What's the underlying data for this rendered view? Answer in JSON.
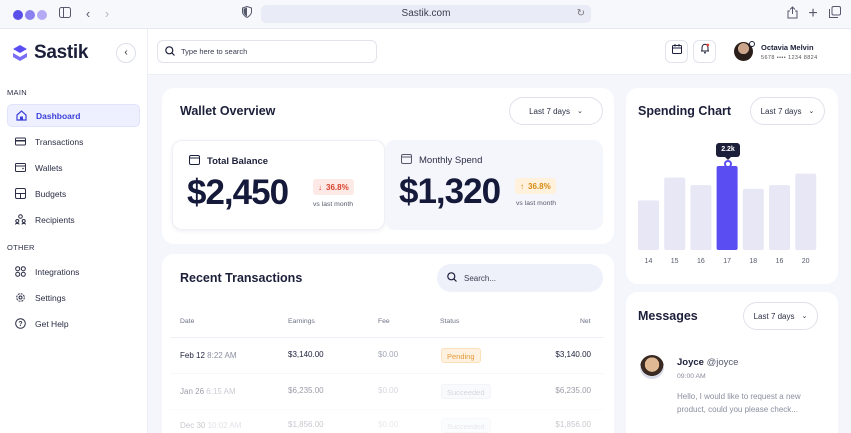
{
  "browser": {
    "url": "Sastik.com"
  },
  "brand": {
    "name": "Sastik",
    "accent": "#5a4df2"
  },
  "sidebar": {
    "main_label": "MAIN",
    "other_label": "OTHER",
    "main_items": [
      {
        "label": "Dashboard",
        "icon": "home-icon",
        "active": true
      },
      {
        "label": "Transactions",
        "icon": "card-icon"
      },
      {
        "label": "Wallets",
        "icon": "wallet-icon"
      },
      {
        "label": "Budgets",
        "icon": "budget-icon"
      },
      {
        "label": "Recipients",
        "icon": "users-icon"
      }
    ],
    "other_items": [
      {
        "label": "Integrations",
        "icon": "grid-icon"
      },
      {
        "label": "Settings",
        "icon": "gear-icon"
      },
      {
        "label": "Get Help",
        "icon": "help-icon"
      }
    ]
  },
  "topbar": {
    "search_placeholder": "Type here to search",
    "user_name": "Octavia Melvin",
    "card_number": "5678 •••• 1234 8824"
  },
  "wallet": {
    "title": "Wallet Overview",
    "range": "Last 7 days",
    "total_label": "Total Balance",
    "total_amount": "$2,450",
    "total_change": "36.8%",
    "total_vs": "vs last month",
    "monthly_label": "Monthly Spend",
    "monthly_amount": "$1,320",
    "monthly_change": "36.8%",
    "monthly_vs": "vs last month"
  },
  "transactions": {
    "title": "Recent Transactions",
    "search_placeholder": "Search...",
    "columns": [
      "Date",
      "Earnings",
      "Fee",
      "Status",
      "Net"
    ],
    "rows": [
      {
        "date": "Feb 12",
        "time": "8:22 AM",
        "earnings": "$3,140.00",
        "fee": "$0.00",
        "status": "Pending",
        "net": "$3,140.00"
      },
      {
        "date": "Jan 26",
        "time": "6:15 AM",
        "earnings": "$6,235.00",
        "fee": "$0.00",
        "status": "Succeeded",
        "net": "$6,235.00"
      },
      {
        "date": "Dec 30",
        "time": "10:02 AM",
        "earnings": "$1,856.00",
        "fee": "$0.00",
        "status": "Succeeded",
        "net": "$1,856.00"
      }
    ]
  },
  "chart_data": {
    "type": "bar",
    "title": "Spending Chart",
    "range": "Last 7 days",
    "categories": [
      "14",
      "15",
      "16",
      "17",
      "18",
      "16",
      "20"
    ],
    "values": [
      1.3,
      1.9,
      1.7,
      2.2,
      1.6,
      1.7,
      2.0
    ],
    "highlight_index": 3,
    "highlight_label": "2.2k",
    "colors": {
      "bar": "#e8e7f5",
      "highlight": "#5a4df2"
    }
  },
  "messages": {
    "title": "Messages",
    "range": "Last 7 days",
    "items": [
      {
        "name": "Joyce",
        "handle": "@joyce",
        "time": "09:00 AM",
        "text": "Hello, I would like to request a new product, could you please check..."
      }
    ]
  }
}
